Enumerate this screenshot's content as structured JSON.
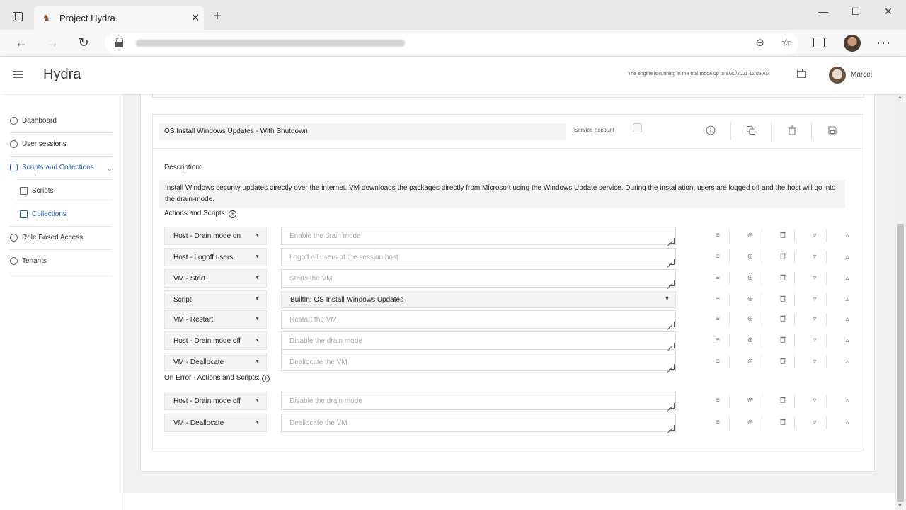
{
  "browser": {
    "tab_title": "Project Hydra",
    "tab_close": "✕",
    "new_tab": "+",
    "minimize": "—",
    "maximize": "☐",
    "close": "✕",
    "back": "←",
    "forward": "→",
    "reload": "↻",
    "more": "···"
  },
  "header": {
    "brand": "Hydra",
    "trial_notice": "The engine is running in the trial mode up to 9/30/2021 11:09 AM",
    "user_name": "Marcel"
  },
  "sidebar": {
    "items": [
      {
        "label": "Dashboard"
      },
      {
        "label": "User sessions"
      },
      {
        "label": "Scripts and Collections"
      },
      {
        "label": "Scripts"
      },
      {
        "label": "Collections"
      },
      {
        "label": "Role Based Access"
      },
      {
        "label": "Tenants"
      }
    ]
  },
  "collection": {
    "name": "OS Install Windows Updates - With Shutdown",
    "service_account_label": "Service account",
    "description_label": "Description:",
    "description": "Install Windows security updates directly over the internet. VM downloads the packages directly from Microsoft using the Windows Update service. During the installation, users are logged off and the host will go into the drain-mode.",
    "actions_label": "Actions and Scripts:",
    "on_error_label": "On Error - Actions and Scripts:",
    "actions": [
      {
        "type": "Host - Drain mode on",
        "text": "Enable the drain mode"
      },
      {
        "type": "Host - Logoff users",
        "text": "Logoff all users of the session host"
      },
      {
        "type": "VM - Start",
        "text": "Starts the VM"
      },
      {
        "type": "Script",
        "text": "BuiltIn: OS Install Windows Updates"
      },
      {
        "type": "VM - Restart",
        "text": "Restart the VM"
      },
      {
        "type": "Host - Drain mode off",
        "text": "Disable the drain mode"
      },
      {
        "type": "VM - Deallocate",
        "text": "Deallocate the VM"
      }
    ],
    "on_error_actions": [
      {
        "type": "Host - Drain mode off",
        "text": "Disable the drain mode"
      },
      {
        "type": "VM - Deallocate",
        "text": "Deallocate the VM"
      }
    ]
  },
  "icons": {
    "row_actions": [
      "drag-handle-icon",
      "add-circle-icon",
      "trash-icon",
      "move-down-icon",
      "move-up-icon"
    ],
    "card_actions": [
      "info-icon",
      "copy-icon",
      "trash-icon",
      "save-icon"
    ]
  },
  "colors": {
    "accent": "#2a5fb8"
  }
}
